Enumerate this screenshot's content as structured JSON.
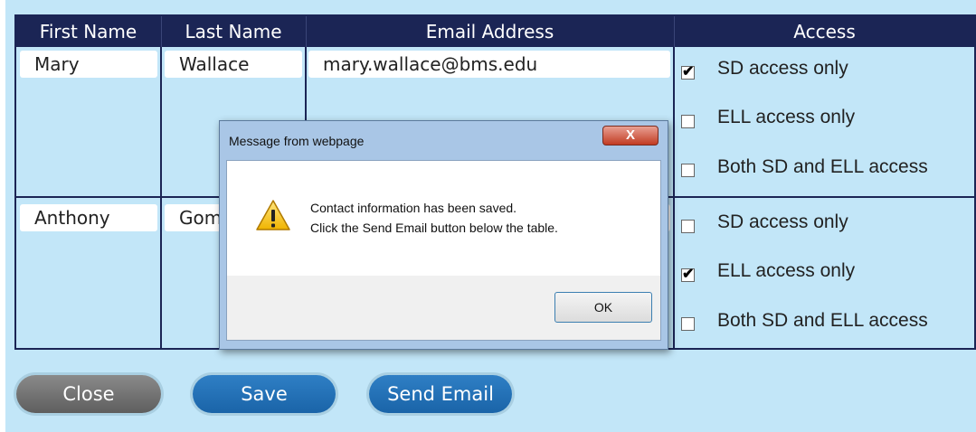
{
  "table": {
    "headers": [
      "First Name",
      "Last Name",
      "Email Address",
      "Access"
    ],
    "rows": [
      {
        "first_name": "Mary",
        "last_name": "Wallace",
        "email": "mary.wallace@bms.edu",
        "access": [
          {
            "label": "SD access only",
            "checked": true
          },
          {
            "label": "ELL access only",
            "checked": false
          },
          {
            "label": "Both SD and ELL access",
            "checked": false
          }
        ]
      },
      {
        "first_name": "Anthony",
        "last_name": "Gom",
        "email": "",
        "access": [
          {
            "label": "SD access only",
            "checked": false
          },
          {
            "label": "ELL access only",
            "checked": true
          },
          {
            "label": "Both SD and ELL access",
            "checked": false
          }
        ]
      }
    ]
  },
  "buttons": {
    "close": "Close",
    "save": "Save",
    "send_email": "Send Email"
  },
  "dialog": {
    "title": "Message from webpage",
    "close_glyph": "X",
    "icon": "warning-icon",
    "message_line1": "Contact information has been saved.",
    "message_line2": "Click the Send Email button below the table.",
    "ok_label": "OK"
  },
  "colors": {
    "header_bg": "#1b2555",
    "page_bg": "#c2e6f8",
    "primary_button": "#1f6db2",
    "close_button": "#6e6e6e"
  }
}
